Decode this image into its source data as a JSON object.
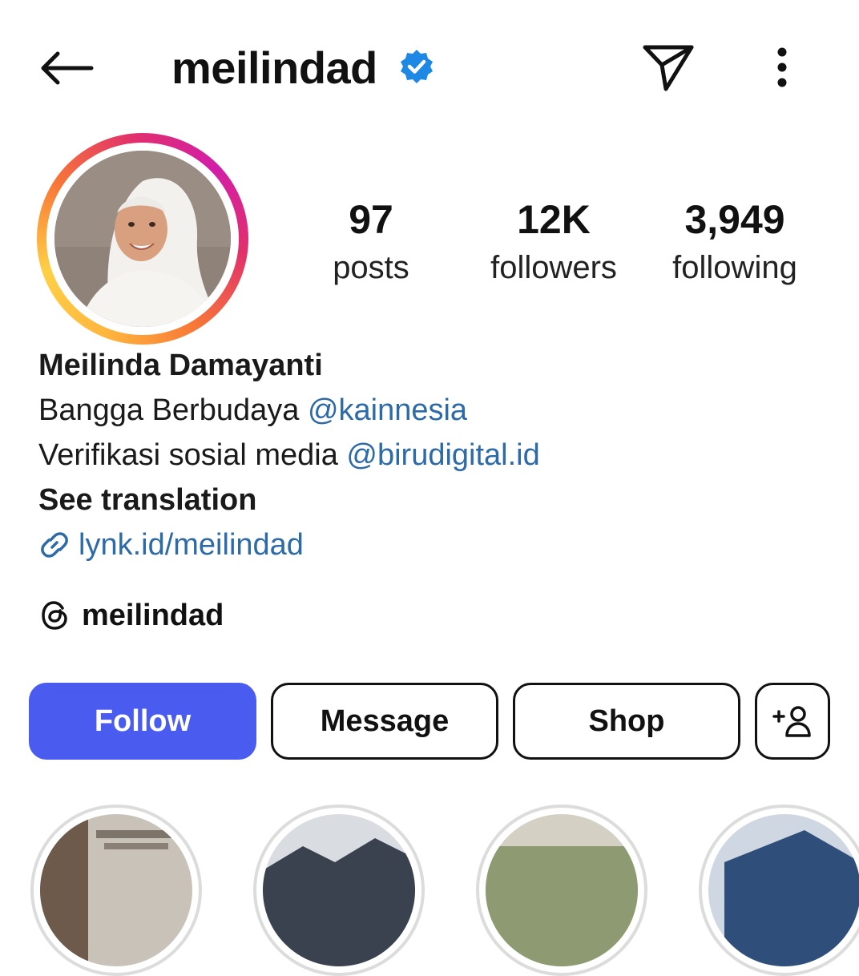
{
  "header": {
    "username": "meilindad",
    "back_icon": "arrow-left-icon",
    "verified_icon": "verified-badge-icon",
    "send_icon": "paper-plane-icon",
    "more_icon": "more-vertical-icon"
  },
  "stats": [
    {
      "value": "97",
      "label": "posts"
    },
    {
      "value": "12K",
      "label": "followers"
    },
    {
      "value": "3,949",
      "label": "following"
    }
  ],
  "bio": {
    "name": "Meilinda Damayanti",
    "line1_text": "Bangga Berbudaya ",
    "line1_mention": "@kainnesia",
    "line2_text": "Verifikasi sosial media ",
    "line2_mention": "@birudigital.id",
    "see_translation": "See translation",
    "link": "lynk.id/meilindad",
    "link_icon": "link-icon",
    "threads_handle": "meilindad",
    "threads_icon": "threads-icon"
  },
  "buttons": {
    "follow": "Follow",
    "message": "Message",
    "shop": "Shop",
    "suggest_icon": "add-person-icon"
  },
  "colors": {
    "follow_button": "#4a5cf0",
    "mention_link": "#2d6aa8",
    "verified_badge": "#1e88e5"
  }
}
